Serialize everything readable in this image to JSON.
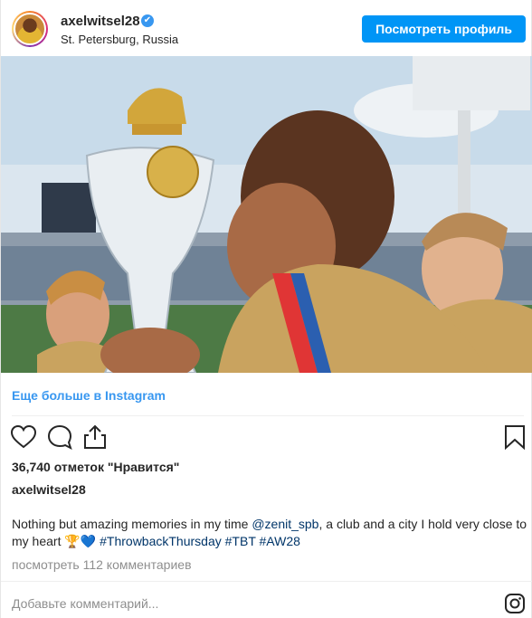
{
  "header": {
    "username": "axelwitsel28",
    "location": "St. Petersburg, Russia",
    "verified_mark": "✔",
    "view_profile": "Посмотреть профиль"
  },
  "photo": {
    "description_icon": "photo-image"
  },
  "more_link": "Еще больше в Instagram",
  "actions": {
    "like_icon": "heart-icon",
    "comment_icon": "comment-icon",
    "share_icon": "share-icon",
    "save_icon": "bookmark-icon"
  },
  "likes": "36,740 отметок \"Нравится\"",
  "author": "axelwitsel28",
  "caption": {
    "text_before": "Nothing but amazing memories in my time ",
    "mention": "@zenit_spb",
    "text_after": ", a club and a city I hold very close to my heart ",
    "emoji": "🏆💙",
    "tag1": "#ThrowbackThursday",
    "tag2": "#TBT",
    "tag3": "#AW28"
  },
  "comments_link": "посмотреть 112 комментариев",
  "add_comment_placeholder": "Добавьте комментарий...",
  "colors": {
    "accent": "#0095f6",
    "link": "#3897f0",
    "hashtag": "#003569",
    "muted": "#8e8e8e"
  }
}
